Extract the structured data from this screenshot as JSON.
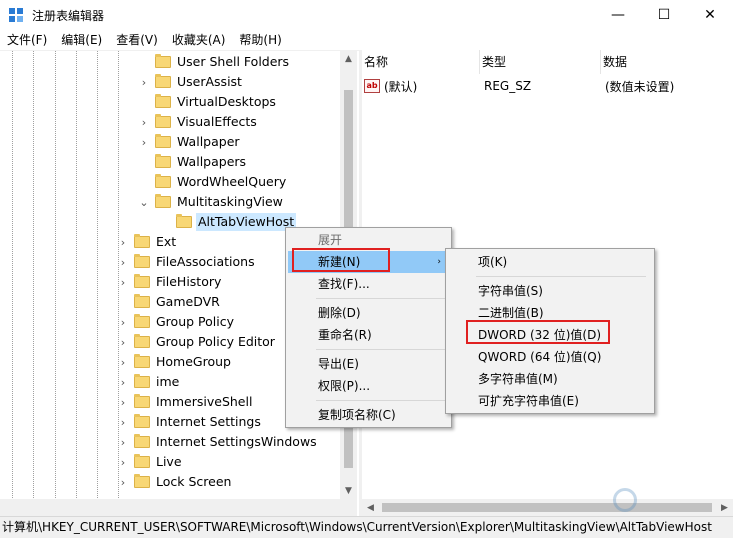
{
  "window": {
    "title": "注册表编辑器",
    "minimize": "—",
    "maximize": "☐",
    "close": "✕"
  },
  "menubar": [
    "文件(F)",
    "编辑(E)",
    "查看(V)",
    "收藏夹(A)",
    "帮助(H)"
  ],
  "tree": {
    "rows": [
      {
        "label": "User Shell Folders",
        "expander": "",
        "level": 2
      },
      {
        "label": "UserAssist",
        "expander": "›",
        "level": 2
      },
      {
        "label": "VirtualDesktops",
        "expander": "",
        "level": 2
      },
      {
        "label": "VisualEffects",
        "expander": "›",
        "level": 2
      },
      {
        "label": "Wallpaper",
        "expander": "›",
        "level": 2
      },
      {
        "label": "Wallpapers",
        "expander": "",
        "level": 2
      },
      {
        "label": "WordWheelQuery",
        "expander": "",
        "level": 2
      },
      {
        "label": "MultitaskingView",
        "expander": "⌄",
        "level": 2
      },
      {
        "label": "AltTabViewHost",
        "expander": "",
        "level": 3,
        "selected": true
      },
      {
        "label": "Ext",
        "expander": "›",
        "level": 1
      },
      {
        "label": "FileAssociations",
        "expander": "›",
        "level": 1
      },
      {
        "label": "FileHistory",
        "expander": "›",
        "level": 1
      },
      {
        "label": "GameDVR",
        "expander": "",
        "level": 1
      },
      {
        "label": "Group Policy",
        "expander": "›",
        "level": 1
      },
      {
        "label": "Group Policy Editor",
        "expander": "›",
        "level": 1
      },
      {
        "label": "HomeGroup",
        "expander": "›",
        "level": 1
      },
      {
        "label": "ime",
        "expander": "›",
        "level": 1
      },
      {
        "label": "ImmersiveShell",
        "expander": "›",
        "level": 1
      },
      {
        "label": "Internet Settings",
        "expander": "›",
        "level": 1
      },
      {
        "label": "Internet SettingsWindows",
        "expander": "›",
        "level": 1
      },
      {
        "label": "Live",
        "expander": "›",
        "level": 1
      },
      {
        "label": "Lock Screen",
        "expander": "›",
        "level": 1
      }
    ]
  },
  "list": {
    "columns": [
      "名称",
      "类型",
      "数据"
    ],
    "rows": [
      {
        "icon": "ab",
        "name": "(默认)",
        "type": "REG_SZ",
        "data": "(数值未设置)"
      }
    ]
  },
  "context_menu": {
    "items": [
      {
        "label": "展开",
        "disabled": true
      },
      {
        "label": "新建(N)",
        "highlight": true,
        "submenu": "›"
      },
      {
        "label": "查找(F)..."
      },
      {
        "separator": true
      },
      {
        "label": "删除(D)"
      },
      {
        "label": "重命名(R)"
      },
      {
        "separator": true
      },
      {
        "label": "导出(E)"
      },
      {
        "label": "权限(P)..."
      },
      {
        "separator": true
      },
      {
        "label": "复制项名称(C)"
      }
    ]
  },
  "submenu": {
    "items": [
      {
        "label": "项(K)"
      },
      {
        "separator": true
      },
      {
        "label": "字符串值(S)"
      },
      {
        "label": "二进制值(B)"
      },
      {
        "label": "DWORD (32 位)值(D)"
      },
      {
        "label": "QWORD (64 位)值(Q)"
      },
      {
        "label": "多字符串值(M)"
      },
      {
        "label": "可扩充字符串值(E)"
      }
    ]
  },
  "statusbar": {
    "path": "计算机\\HKEY_CURRENT_USER\\SOFTWARE\\Microsoft\\Windows\\CurrentVersion\\Explorer\\MultitaskingView\\AltTabViewHost"
  },
  "colors": {
    "highlight": "#91c9f7",
    "selection": "#cce8ff",
    "annotation": "#e02020",
    "folder": "#f8d775"
  }
}
